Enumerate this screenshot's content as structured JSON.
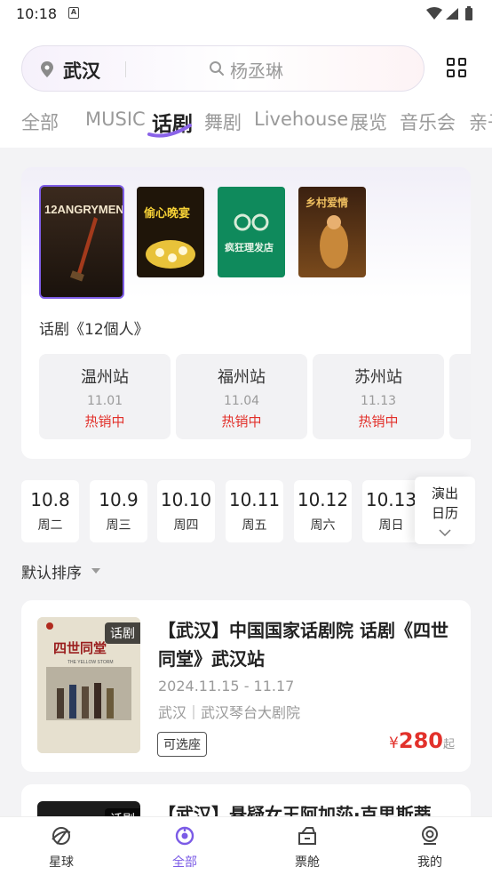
{
  "status": {
    "time": "10:18",
    "notif_letter": "A"
  },
  "header": {
    "city": "武汉",
    "search_placeholder": "杨丞琳",
    "tabs": [
      "全部",
      "MUSIC",
      "话剧",
      "舞剧",
      "Livehouse",
      "展览",
      "音乐会",
      "亲子"
    ],
    "active_tab": "话剧"
  },
  "featured": {
    "title": "话剧《12個人》",
    "posters": [
      {
        "label": "12ANGRYMEN",
        "selected": true
      },
      {
        "label": "偷心晚宴"
      },
      {
        "label": "疯狂理发店"
      },
      {
        "label": "乡村爱情"
      }
    ],
    "stations": [
      {
        "name": "温州站",
        "date": "11.01",
        "status": "热销中"
      },
      {
        "name": "福州站",
        "date": "11.04",
        "status": "热销中"
      },
      {
        "name": "苏州站",
        "date": "11.13",
        "status": "热销中"
      }
    ]
  },
  "dates": [
    {
      "day": "10.8",
      "week": "周二"
    },
    {
      "day": "10.9",
      "week": "周三"
    },
    {
      "day": "10.10",
      "week": "周四"
    },
    {
      "day": "10.11",
      "week": "周五"
    },
    {
      "day": "10.12",
      "week": "周六"
    },
    {
      "day": "10.13",
      "week": "周日"
    }
  ],
  "calendar_btn": {
    "line1": "演出",
    "line2": "日历"
  },
  "sort": {
    "label": "默认排序"
  },
  "events": [
    {
      "tag": "话剧",
      "title": "【武汉】中国国家话剧院 话剧《四世同堂》武汉站",
      "poster_text": "四世同堂",
      "poster_sub": "THE YELLOW STORM",
      "date": "2024.11.15 - 11.17",
      "venue": "武汉｜武汉琴台大剧院",
      "seat": "可选座",
      "price_symbol": "¥",
      "price": "280",
      "price_suffix": "起"
    },
    {
      "tag": "话剧",
      "title": "【武汉】悬疑女王阿加莎·克里斯蒂"
    }
  ],
  "bottom_nav": [
    {
      "label": "星球",
      "icon": "planet-icon"
    },
    {
      "label": "全部",
      "icon": "all-icon",
      "active": true
    },
    {
      "label": "票舱",
      "icon": "ticket-icon"
    },
    {
      "label": "我的",
      "icon": "profile-icon"
    }
  ],
  "colors": {
    "accent": "#7b5be6",
    "price": "#e2312b"
  }
}
